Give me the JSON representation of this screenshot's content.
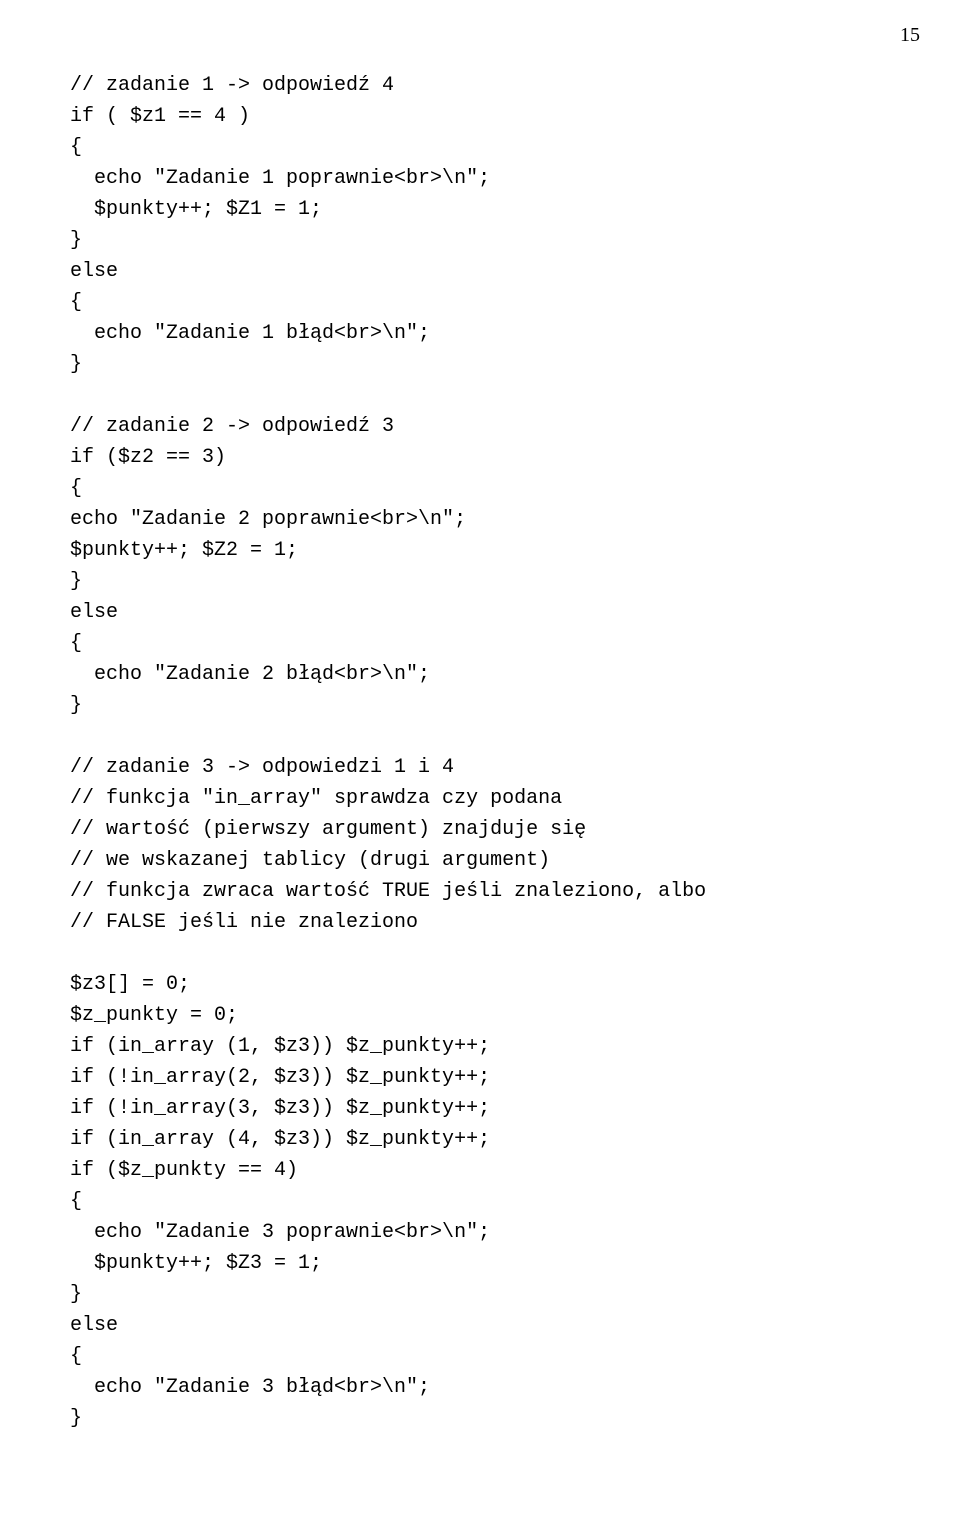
{
  "pageNumber": "15",
  "lines": [
    "// zadanie 1 -> odpowiedź 4",
    "if ( $z1 == 4 )",
    "{",
    "  echo \"Zadanie 1 poprawnie<br>\\n\";",
    "  $punkty++; $Z1 = 1;",
    "}",
    "else",
    "{",
    "  echo \"Zadanie 1 błąd<br>\\n\";",
    "}",
    "",
    "// zadanie 2 -> odpowiedź 3",
    "if ($z2 == 3)",
    "{",
    "echo \"Zadanie 2 poprawnie<br>\\n\";",
    "$punkty++; $Z2 = 1;",
    "}",
    "else",
    "{",
    "  echo \"Zadanie 2 błąd<br>\\n\";",
    "}",
    "",
    "// zadanie 3 -> odpowiedzi 1 i 4",
    "// funkcja \"in_array\" sprawdza czy podana",
    "// wartość (pierwszy argument) znajduje się",
    "// we wskazanej tablicy (drugi argument)",
    "// funkcja zwraca wartość TRUE jeśli znaleziono, albo",
    "// FALSE jeśli nie znaleziono",
    "",
    "$z3[] = 0;",
    "$z_punkty = 0;",
    "if (in_array (1, $z3)) $z_punkty++;",
    "if (!in_array(2, $z3)) $z_punkty++;",
    "if (!in_array(3, $z3)) $z_punkty++;",
    "if (in_array (4, $z3)) $z_punkty++;",
    "if ($z_punkty == 4)",
    "{",
    "  echo \"Zadanie 3 poprawnie<br>\\n\";",
    "  $punkty++; $Z3 = 1;",
    "}",
    "else",
    "{",
    "  echo \"Zadanie 3 błąd<br>\\n\";",
    "}"
  ]
}
